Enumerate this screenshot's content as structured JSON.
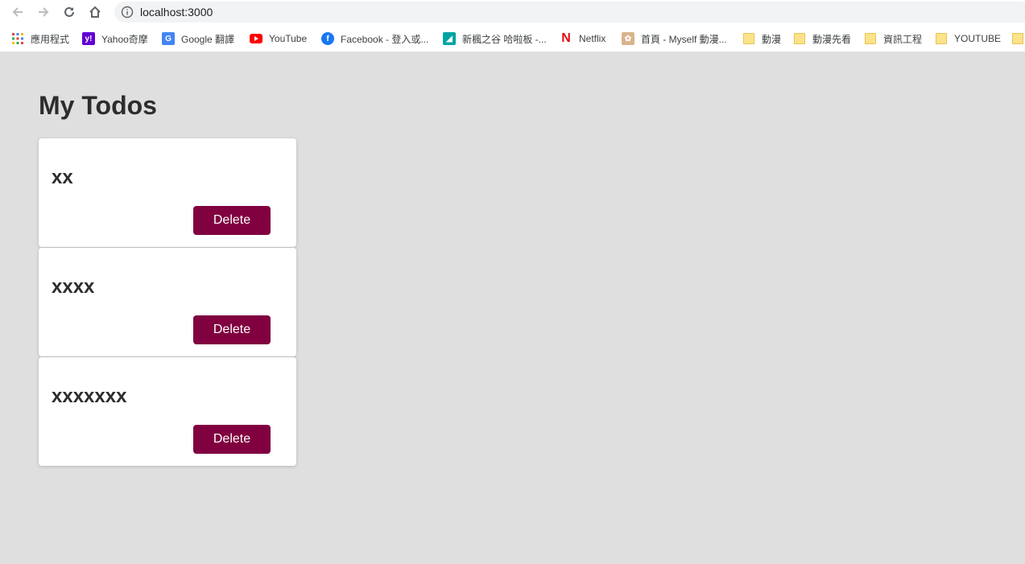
{
  "browser": {
    "url": "localhost:3000",
    "bookmarks": [
      {
        "label": "應用程式",
        "icon": "apps-grid-icon"
      },
      {
        "label": "Yahoo奇摩",
        "icon": "yahoo-icon"
      },
      {
        "label": "Google 翻譯",
        "icon": "google-translate-icon"
      },
      {
        "label": "YouTube",
        "icon": "youtube-icon"
      },
      {
        "label": "Facebook - 登入或...",
        "icon": "facebook-icon"
      },
      {
        "label": "新楓之谷 哈啦板 -...",
        "icon": "gamer-icon"
      },
      {
        "label": "Netflix",
        "icon": "netflix-icon"
      },
      {
        "label": "首頁 - Myself 動漫...",
        "icon": "myself-icon"
      },
      {
        "label": "動漫",
        "icon": "folder-icon"
      },
      {
        "label": "動漫先看",
        "icon": "folder-icon"
      },
      {
        "label": "資訊工程",
        "icon": "folder-icon"
      },
      {
        "label": "YOUTUBE",
        "icon": "folder-icon"
      }
    ]
  },
  "page": {
    "title": "My Todos",
    "todos": [
      {
        "text": "xx",
        "delete_label": "Delete"
      },
      {
        "text": "xxxx",
        "delete_label": "Delete"
      },
      {
        "text": "xxxxxxx",
        "delete_label": "Delete"
      }
    ]
  },
  "colors": {
    "background": "#dfdfdf",
    "card": "#ffffff",
    "button": "#800040",
    "text": "#2d2d2d"
  }
}
